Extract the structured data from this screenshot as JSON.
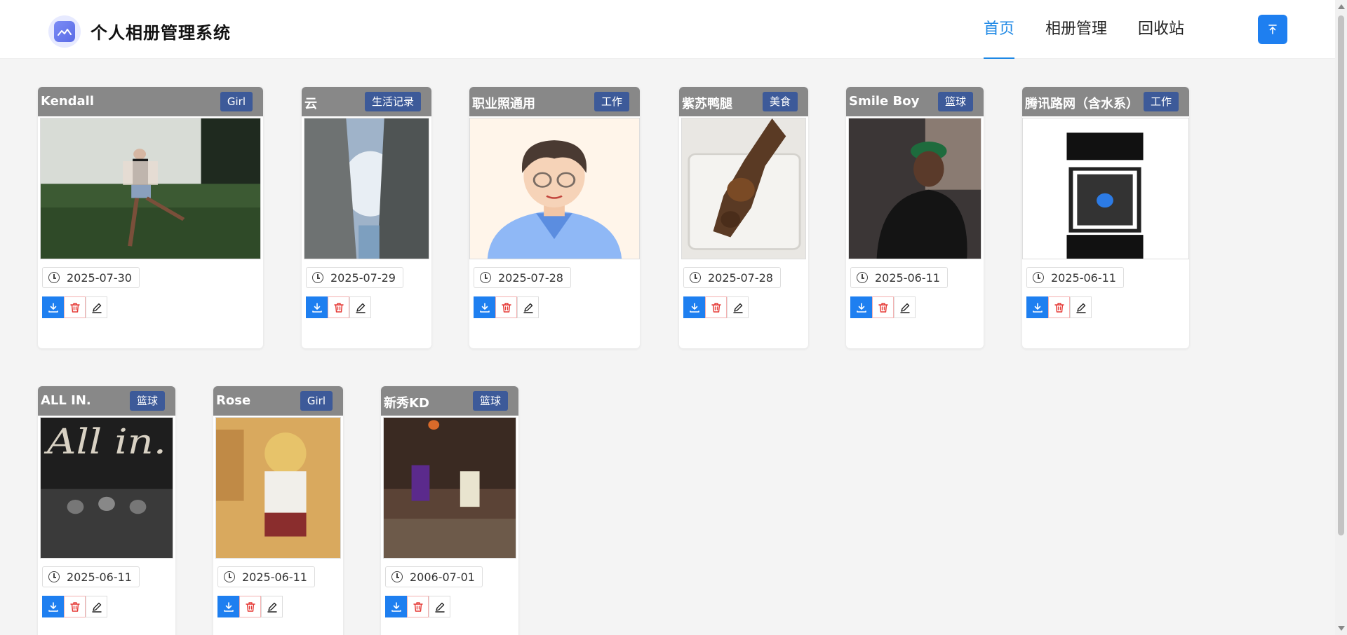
{
  "app": {
    "title": "个人相册管理系统"
  },
  "nav": {
    "items": [
      "首页",
      "相册管理",
      "回收站"
    ],
    "active_index": 0
  },
  "colors": {
    "accent": "#1e88e5",
    "tag_bg": "#3d5a99",
    "card_header": "#888888",
    "download_btn": "#1e7ff0",
    "delete_icon": "#e53935"
  },
  "icons": {
    "top_button": "arrow-to-top-icon",
    "date": "clock-icon",
    "download": "download-icon",
    "delete": "trash-icon",
    "edit": "pencil-icon"
  },
  "photos": [
    {
      "name": "Kendall",
      "tag": "Girl",
      "date": "2025-07-30"
    },
    {
      "name": "云",
      "tag": "生活记录",
      "date": "2025-07-29"
    },
    {
      "name": "职业照通用",
      "tag": "工作",
      "date": "2025-07-28"
    },
    {
      "name": "紫苏鸭腿",
      "tag": "美食",
      "date": "2025-07-28"
    },
    {
      "name": "Smile Boy",
      "tag": "篮球",
      "date": "2025-06-11"
    },
    {
      "name": "腾讯路网（含水系）",
      "tag": "工作",
      "date": "2025-06-11"
    },
    {
      "name": "ALL IN.",
      "tag": "篮球",
      "date": "2025-06-11"
    },
    {
      "name": "Rose",
      "tag": "Girl",
      "date": "2025-06-11"
    },
    {
      "name": "新秀KD",
      "tag": "篮球",
      "date": "2006-07-01"
    }
  ]
}
